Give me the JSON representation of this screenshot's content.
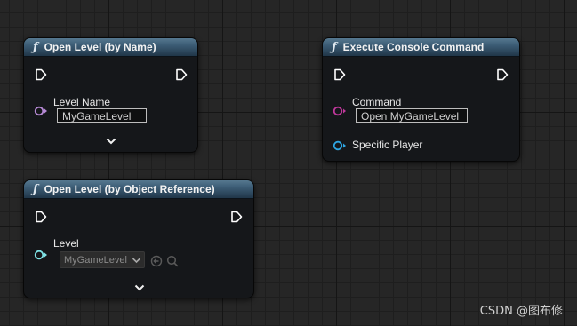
{
  "nodes": {
    "open_level_by_name": {
      "icon": "function-icon",
      "title": "Open Level (by Name)",
      "pins": {
        "level_name": {
          "label": "Level Name",
          "value": "MyGameLevel"
        }
      }
    },
    "execute_console_command": {
      "icon": "function-icon",
      "title": "Execute Console Command",
      "pins": {
        "command": {
          "label": "Command",
          "value": "Open MyGameLevel"
        },
        "specific_player": {
          "label": "Specific Player"
        }
      }
    },
    "open_level_by_object_reference": {
      "icon": "function-icon",
      "title": "Open Level (by Object Reference)",
      "pins": {
        "level": {
          "label": "Level",
          "selected": "MyGameLevel"
        }
      }
    }
  },
  "icons": {
    "function": "ƒ"
  },
  "colors": {
    "string_pin": "#c0389c",
    "name_pin": "#b78ad6",
    "object_pin": "#2ea6e3",
    "soft_object_pin": "#7fe3e6",
    "header": "#3e5f78"
  },
  "watermark": "CSDN @图布修"
}
